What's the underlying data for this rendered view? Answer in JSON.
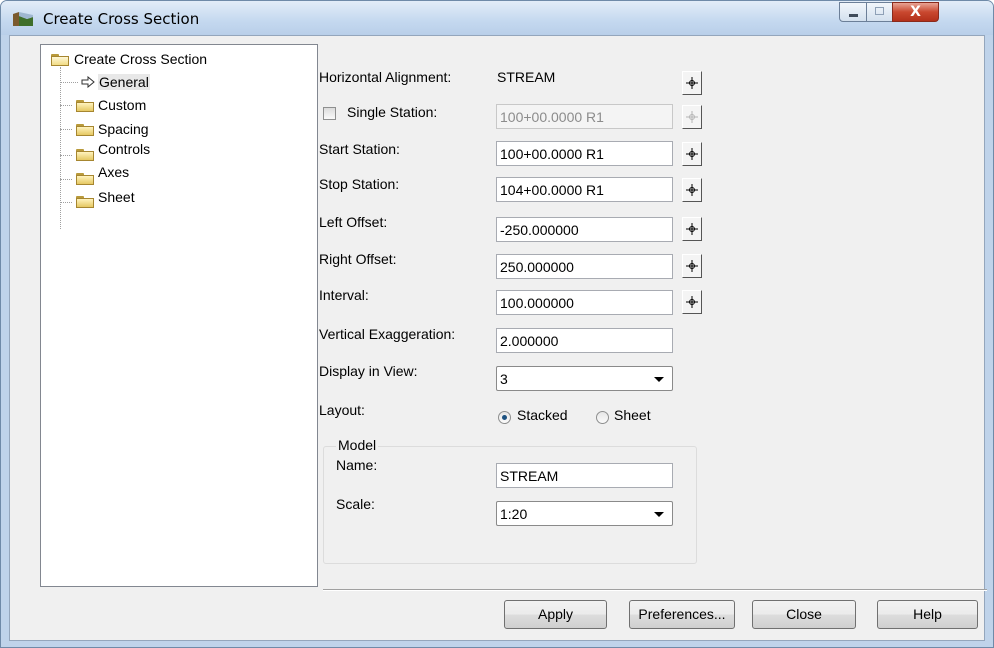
{
  "window": {
    "title": "Create Cross Section",
    "controls": {
      "close_label": "X"
    }
  },
  "tree": {
    "root": "Create Cross Section",
    "items": [
      {
        "label": "General",
        "icon": "arrow-right-icon",
        "selected": true
      },
      {
        "label": "Custom",
        "icon": "folder-icon"
      },
      {
        "label": "Spacing",
        "icon": "folder-icon"
      },
      {
        "label": "Controls",
        "icon": "folder-icon"
      },
      {
        "label": "Axes",
        "icon": "folder-icon"
      },
      {
        "label": "Sheet",
        "icon": "folder-icon"
      }
    ]
  },
  "form": {
    "horizontal_alignment": {
      "label": "Horizontal Alignment:",
      "value": "STREAM"
    },
    "single_station": {
      "label": "Single Station:",
      "value": "100+00.0000 R1",
      "checked": false
    },
    "start_station": {
      "label": "Start Station:",
      "value": "100+00.0000 R1"
    },
    "stop_station": {
      "label": "Stop Station:",
      "value": "104+00.0000 R1"
    },
    "left_offset": {
      "label": "Left Offset:",
      "value": "-250.000000"
    },
    "right_offset": {
      "label": "Right Offset:",
      "value": "250.000000"
    },
    "interval": {
      "label": "Interval:",
      "value": "100.000000"
    },
    "vertical_exaggeration": {
      "label": "Vertical Exaggeration:",
      "value": "2.000000"
    },
    "display_in_view": {
      "label": "Display in View:",
      "value": "3"
    },
    "layout": {
      "label": "Layout:",
      "options": [
        "Stacked",
        "Sheet"
      ],
      "selected": "Stacked"
    },
    "model": {
      "title": "Model",
      "name_label": "Name:",
      "name_value": "STREAM",
      "scale_label": "Scale:",
      "scale_value": "1:20"
    }
  },
  "buttons": {
    "apply": "Apply",
    "preferences": "Preferences...",
    "close": "Close",
    "help": "Help"
  },
  "colors": {
    "titlebar": "#c4d8ef",
    "close_button": "#c9482f",
    "radio_selected": "#1c5180",
    "dialog_bg": "#f0f0f0"
  }
}
